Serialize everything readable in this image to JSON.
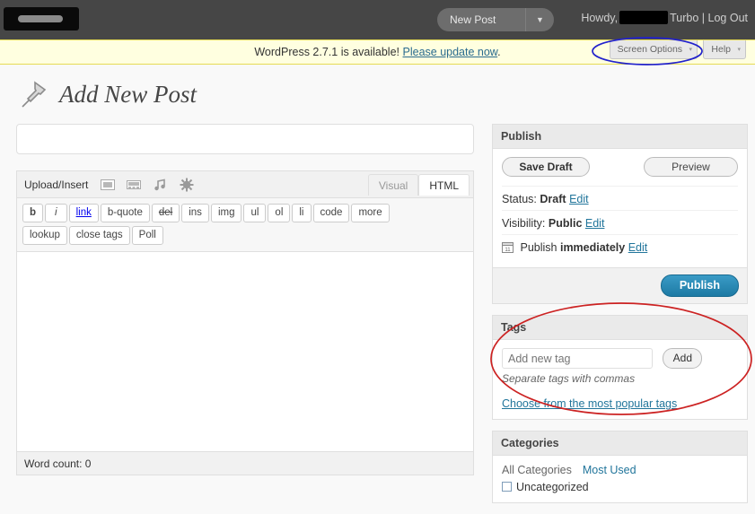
{
  "adminbar": {
    "logo_alt": "wordpress-logo-redacted",
    "new_post_label": "New Post",
    "caret": "▼",
    "howdy_prefix": "Howdy,",
    "username_redacted": "",
    "turbo_label": "Turbo",
    "separator": "|",
    "logout_label": "Log Out"
  },
  "update_notice": {
    "text": "WordPress 2.7.1 is available!",
    "link_label": "Please update now",
    "suffix": "."
  },
  "screen_meta": {
    "screen_options_label": "Screen Options",
    "help_label": "Help",
    "arrow": "▾"
  },
  "page": {
    "title": "Add New Post",
    "pin_icon": "pushpin-icon"
  },
  "post_form": {
    "title_placeholder": "",
    "title_value": ""
  },
  "media_bar": {
    "upload_label": "Upload/Insert",
    "icons": [
      "image-icon",
      "video-icon",
      "audio-icon",
      "media-icon"
    ]
  },
  "editor_tabs": {
    "visual_label": "Visual",
    "html_label": "HTML",
    "active": "HTML"
  },
  "quicktags": {
    "row1": [
      "b",
      "i",
      "link",
      "b-quote",
      "del",
      "ins",
      "img",
      "ul",
      "ol",
      "li",
      "code",
      "more"
    ],
    "row2": [
      "lookup",
      "close tags",
      "Poll"
    ]
  },
  "editor": {
    "content": "",
    "word_count_label": "Word count: 0"
  },
  "publish_box": {
    "heading": "Publish",
    "save_draft_label": "Save Draft",
    "preview_label": "Preview",
    "status_label": "Status:",
    "status_value": "Draft",
    "status_edit": "Edit",
    "visibility_label": "Visibility:",
    "visibility_value": "Public",
    "visibility_edit": "Edit",
    "schedule_prefix": "Publish",
    "schedule_value": "immediately",
    "schedule_edit": "Edit",
    "calendar_icon": "calendar-icon",
    "publish_label": "Publish"
  },
  "tags_box": {
    "heading": "Tags",
    "input_placeholder": "Add new tag",
    "input_value": "",
    "add_label": "Add",
    "hint": "Separate tags with commas",
    "popular_link": "Choose from the most popular tags"
  },
  "categories_box": {
    "heading": "Categories",
    "tab_all": "All Categories",
    "tab_most_used": "Most Used",
    "items": [
      {
        "label": "Uncategorized",
        "checked": false
      }
    ]
  },
  "annotations": [
    {
      "name": "screen-options-ellipse",
      "color": "#2222cc",
      "shape": "ellipse"
    },
    {
      "name": "tags-box-ellipse",
      "color": "#cc2222",
      "shape": "ellipse"
    }
  ],
  "colors": {
    "adminbar_bg": "#464646",
    "notice_bg": "#ffffe0",
    "publish_button": "#1d7aa4",
    "link": "#21759b",
    "annotation_blue": "#2222cc",
    "annotation_red": "#cc2222"
  }
}
